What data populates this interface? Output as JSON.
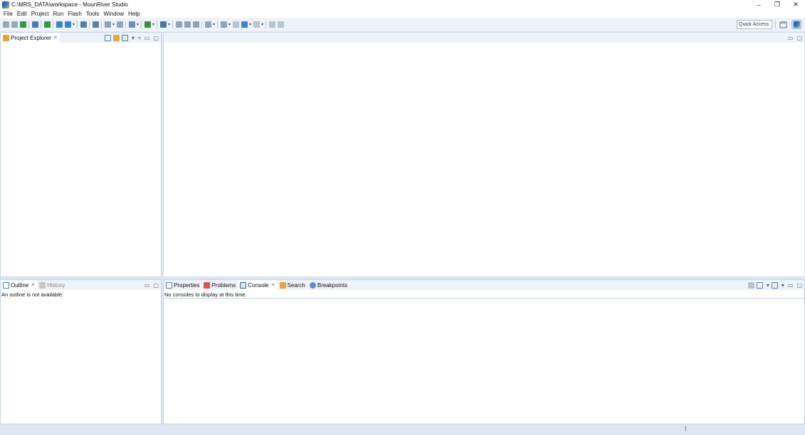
{
  "window": {
    "title": "C:\\MRS_DATA\\workspace - MounRiver Studio",
    "controls": {
      "minimize": "–",
      "restore": "❐",
      "close": "✕"
    }
  },
  "menu": [
    "File",
    "Edit",
    "Project",
    "Run",
    "Flash",
    "Tools",
    "Window",
    "Help"
  ],
  "toolbar": {
    "quick_access": "Quick Access",
    "icons": [
      {
        "name": "new-icon",
        "color": "#9aa7b5"
      },
      {
        "name": "save-icon",
        "color": "#9aa7b5"
      },
      {
        "name": "build-project-icon",
        "color": "#2f9a44"
      },
      {
        "name": "separator"
      },
      {
        "name": "print-icon",
        "color": "#4a7bb7"
      },
      {
        "name": "separator"
      },
      {
        "name": "download-icon",
        "color": "#2f9a44"
      },
      {
        "name": "separator"
      },
      {
        "name": "target-config-icon",
        "color": "#3d85c6"
      },
      {
        "name": "debug-config-icon",
        "color": "#3d85c6"
      },
      {
        "name": "dropdown"
      },
      {
        "name": "separator"
      },
      {
        "name": "terminal-icon",
        "color": "#5c7fa6"
      },
      {
        "name": "separator"
      },
      {
        "name": "serial-icon",
        "color": "#5c7fa6"
      },
      {
        "name": "separator"
      },
      {
        "name": "flash-erase-icon",
        "color": "#8fa4bb"
      },
      {
        "name": "dropdown"
      },
      {
        "name": "flash-verify-icon",
        "color": "#8fa4bb"
      },
      {
        "name": "separator"
      },
      {
        "name": "package-icon",
        "color": "#6a8fc0"
      },
      {
        "name": "dropdown"
      },
      {
        "name": "separator"
      },
      {
        "name": "debug-icon",
        "color": "#3b8f3b"
      },
      {
        "name": "dropdown"
      },
      {
        "name": "separator"
      },
      {
        "name": "search-tool-icon",
        "color": "#4a74b0"
      },
      {
        "name": "dropdown"
      },
      {
        "name": "separator"
      },
      {
        "name": "format-icon",
        "color": "#8fa4bb"
      },
      {
        "name": "indent-icon",
        "color": "#8fa4bb"
      },
      {
        "name": "outdent-icon",
        "color": "#8fa4bb"
      },
      {
        "name": "separator"
      },
      {
        "name": "next-annotation-icon",
        "color": "#8fa4bb"
      },
      {
        "name": "dropdown"
      },
      {
        "name": "separator"
      },
      {
        "name": "previous-annotation-icon",
        "color": "#8fa4bb"
      },
      {
        "name": "dropdown"
      },
      {
        "name": "last-edit-icon",
        "color": "#b7c3d1"
      },
      {
        "name": "back-icon",
        "color": "#3d85c6"
      },
      {
        "name": "dropdown"
      },
      {
        "name": "forward-icon",
        "color": "#b7c3d1"
      },
      {
        "name": "dropdown"
      },
      {
        "name": "separator"
      },
      {
        "name": "pin-editor-icon",
        "color": "#b7c3d1"
      },
      {
        "name": "link-icon",
        "color": "#b7c3d1"
      }
    ]
  },
  "project_explorer": {
    "tab_label": "Project Explorer",
    "close_glyph": "✕"
  },
  "outline_panel": {
    "tabs": [
      {
        "label": "Outline",
        "active": true
      },
      {
        "label": "History",
        "active": false
      }
    ],
    "message": "An outline is not available."
  },
  "console_panel": {
    "tabs": [
      {
        "label": "Properties"
      },
      {
        "label": "Problems"
      },
      {
        "label": "Console",
        "active": true
      },
      {
        "label": "Search"
      },
      {
        "label": "Breakpoints"
      }
    ],
    "message": "No consoles to display at this time."
  },
  "colors": {
    "workbench_bg": "#dde7f3",
    "panel_header": "#eef3fa",
    "panel_border": "#c7d3e2"
  }
}
